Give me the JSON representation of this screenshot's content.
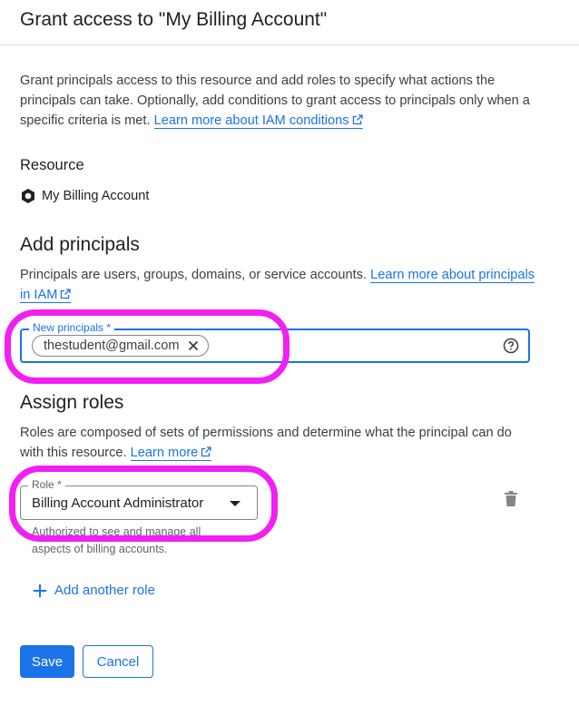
{
  "header": {
    "title": "Grant access to \"My Billing Account\""
  },
  "intro": {
    "text": "Grant principals access to this resource and add roles to specify what actions the principals can take. Optionally, add conditions to grant access to principals only when a specific criteria is met.",
    "link": "Learn more about IAM conditions"
  },
  "resource": {
    "label": "Resource",
    "name": "My Billing Account",
    "icon": "billing-account-icon"
  },
  "principals": {
    "title": "Add principals",
    "description": "Principals are users, groups, domains, or service accounts.",
    "link": "Learn more about principals in IAM",
    "field_label": "New principals *",
    "chips": [
      "thestudent@gmail.com"
    ]
  },
  "roles": {
    "title": "Assign roles",
    "description": "Roles are composed of sets of permissions and determine what the principal can do with this resource.",
    "link": "Learn more",
    "role_label": "Role *",
    "role_value": "Billing Account Administrator",
    "role_description": "Authorized to see and manage all aspects of billing accounts.",
    "add_role_label": "Add another role"
  },
  "actions": {
    "save": "Save",
    "cancel": "Cancel"
  },
  "colors": {
    "accent": "#1a73e8",
    "highlight": "#f21ff3",
    "text": "#202124",
    "muted": "#5f6368"
  }
}
